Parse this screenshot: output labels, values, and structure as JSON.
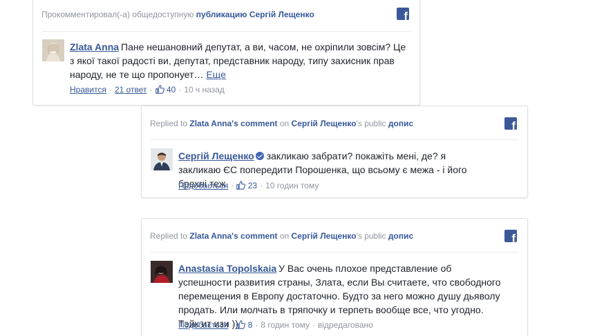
{
  "card1": {
    "header_prefix": "Прокомментировал(-а) общедоступную",
    "header_link": "публикацию Сергій Лещенко",
    "comment": {
      "author": "Zlata Anna",
      "text": "Пане нешановний депутат, а ви, часом, не охріпили зовсім? Це з якої такої радості ви, депутат, представник народу, типу захисник прав народу, не те що пропонует…",
      "more": "Еще"
    },
    "meta": {
      "like": "Нравится",
      "replies": "21 ответ",
      "likes": "40",
      "time": "10 ч назад"
    }
  },
  "card2": {
    "header": {
      "prefix": "Replied to",
      "comment_link": "Zlata Anna's comment",
      "on": "on",
      "page_link": "Сергій Лещенко",
      "suffix": "'s public",
      "post_link": "допис"
    },
    "comment": {
      "author": "Сергій Лещенко",
      "text": "закликаю забрати? покажіть мені, де? я закликаю ЄС попередити Порошенка, що всьому є межа - і його брехні теж"
    },
    "meta": {
      "like": "Подобається",
      "likes": "23",
      "time": "10 годин тому"
    }
  },
  "card3": {
    "header": {
      "prefix": "Replied to",
      "comment_link": "Zlata Anna's comment",
      "on": "on",
      "page_link": "Сергій Лещенко",
      "suffix": "'s public",
      "post_link": "допис"
    },
    "comment": {
      "author": "Anastasia Topolskaia",
      "text": "У Вас очень плохое представление об успешности развития страны, Злата, если Вы считаете, что свободного перемещения в Европу достаточно. Будто за него можно душу дьяволу продать. Или молчать в тряпочку и терпеть вообще все, что угодно. Тэйк ит изи ))"
    },
    "meta": {
      "like": "Подобається",
      "likes": "8",
      "time": "8 годин тому",
      "edited": "відредаговано"
    }
  },
  "icons": {
    "facebook": "facebook-icon",
    "like": "thumbs-up-icon",
    "verified": "verified-badge-icon"
  },
  "colors": {
    "link": "#365899",
    "brand": "#3b5998",
    "meta": "#90949c"
  }
}
